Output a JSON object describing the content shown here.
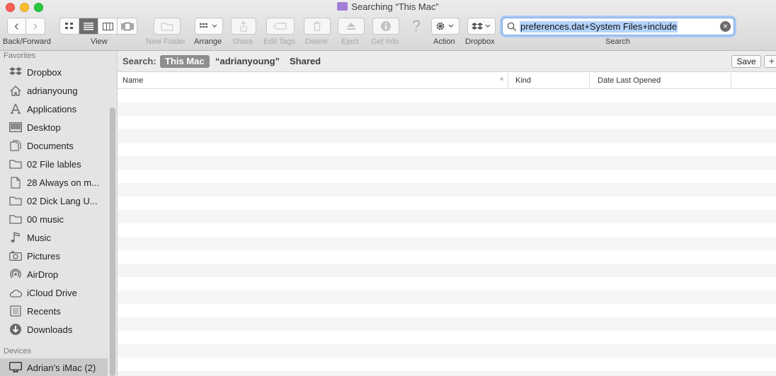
{
  "window": {
    "title": "Searching “This Mac”"
  },
  "toolbar": {
    "back_forward_label": "Back/Forward",
    "view_label": "View",
    "new_folder_label": "New Folder",
    "arrange_label": "Arrange",
    "share_label": "Share",
    "edit_tags_label": "Edit Tags",
    "delete_label": "Delete",
    "eject_label": "Eject",
    "get_info_label": "Get Info",
    "action_label": "Action",
    "dropbox_label": "Dropbox",
    "search_label": "Search",
    "help_glyph": "?",
    "back_glyph": "‹",
    "forward_glyph": "›"
  },
  "search": {
    "query": "preferences.dat+System Files+include"
  },
  "sidebar": {
    "favorites_heading": "Favorites",
    "favorites": [
      {
        "label": "Dropbox",
        "icon": "dropbox-icon"
      },
      {
        "label": "adrianyoung",
        "icon": "home-icon"
      },
      {
        "label": "Applications",
        "icon": "applications-icon"
      },
      {
        "label": "Desktop",
        "icon": "desktop-icon"
      },
      {
        "label": "Documents",
        "icon": "documents-icon"
      },
      {
        "label": "02 File lables",
        "icon": "folder-icon"
      },
      {
        "label": "28 Always on m...",
        "icon": "document-icon"
      },
      {
        "label": "02 Dick Lang U...",
        "icon": "folder-icon"
      },
      {
        "label": "00 music",
        "icon": "folder-icon"
      },
      {
        "label": "Music",
        "icon": "music-icon"
      },
      {
        "label": "Pictures",
        "icon": "pictures-icon"
      },
      {
        "label": "AirDrop",
        "icon": "airdrop-icon"
      },
      {
        "label": "iCloud Drive",
        "icon": "cloud-icon"
      },
      {
        "label": "Recents",
        "icon": "recents-icon"
      },
      {
        "label": "Downloads",
        "icon": "downloads-icon"
      }
    ],
    "devices_heading": "Devices",
    "devices": [
      {
        "label": "Adrian’s iMac (2)",
        "icon": "imac-icon"
      }
    ]
  },
  "scope": {
    "label": "Search:",
    "options": [
      "This Mac",
      "“adrianyoung”",
      "Shared"
    ],
    "save_label": "Save",
    "plus_label": "+"
  },
  "list": {
    "columns": [
      "Name",
      "Kind",
      "Date Last Opened"
    ],
    "sort_indicator": "^"
  },
  "colors": {
    "selection_highlight": "#b4d3fc",
    "scope_active": "#8e8e8e",
    "sidebar_bg": "#e4e4e4"
  }
}
